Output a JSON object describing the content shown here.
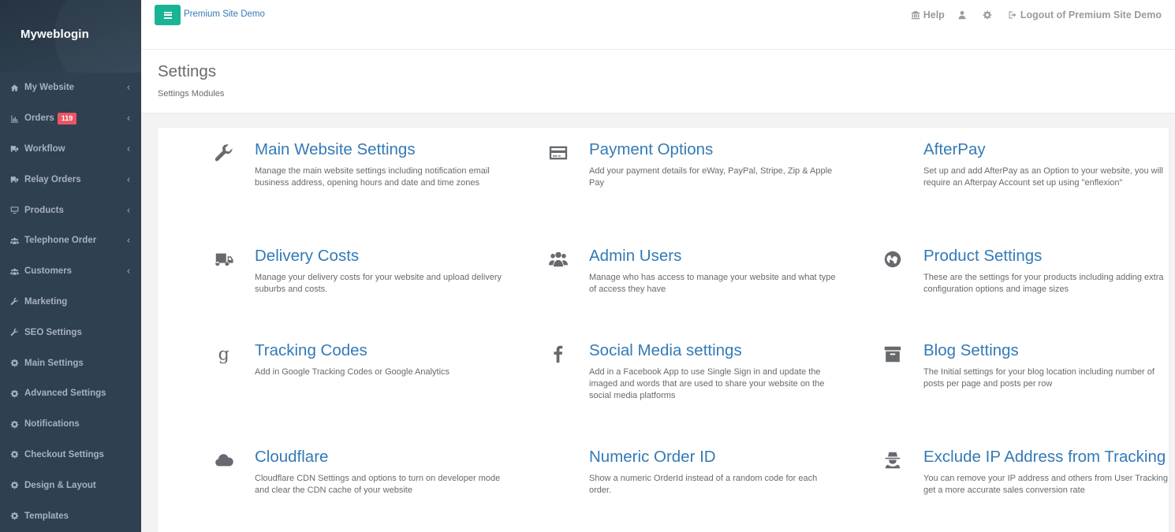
{
  "sidebar": {
    "brand": "Myweblogin",
    "items": [
      {
        "label": "My Website",
        "icon": "home-icon",
        "arrow": "‹"
      },
      {
        "label": "Orders",
        "icon": "bar-chart-icon",
        "arrow": "‹",
        "badge": "119"
      },
      {
        "label": "Workflow",
        "icon": "truck-icon",
        "arrow": "‹"
      },
      {
        "label": "Relay Orders",
        "icon": "truck-icon",
        "arrow": "‹"
      },
      {
        "label": "Products",
        "icon": "desktop-icon",
        "arrow": "‹"
      },
      {
        "label": "Telephone Order",
        "icon": "users-icon",
        "arrow": "‹"
      },
      {
        "label": "Customers",
        "icon": "users-icon",
        "arrow": "‹"
      },
      {
        "label": "Marketing",
        "icon": "wrench-icon"
      },
      {
        "label": "SEO Settings",
        "icon": "wrench-icon"
      },
      {
        "label": "Main Settings",
        "icon": "gear-icon"
      },
      {
        "label": "Advanced Settings",
        "icon": "gear-icon"
      },
      {
        "label": "Notifications",
        "icon": "gear-icon"
      },
      {
        "label": "Checkout Settings",
        "icon": "gear-icon"
      },
      {
        "label": "Design & Layout",
        "icon": "gear-icon"
      },
      {
        "label": "Templates",
        "icon": "gear-icon"
      }
    ]
  },
  "topbar": {
    "site_name": "Premium Site Demo",
    "help_label": "Help",
    "logout_label": "Logout of Premium Site Demo"
  },
  "heading": {
    "title": "Settings",
    "subtitle": "Settings Modules"
  },
  "modules": [
    {
      "title": "Main Website Settings",
      "icon": "wrench-icon",
      "desc": "Manage the main website settings including notification email business address, opening hours and date and time zones"
    },
    {
      "title": "Payment Options",
      "icon": "credit-card-icon",
      "desc": "Add your payment details for eWay, PayPal, Stripe, Zip & Apple Pay"
    },
    {
      "title": "AfterPay",
      "icon": "",
      "desc": "Set up and add AfterPay as an Option to your website, you will require an Afterpay Account set up using \"enflexion\""
    },
    {
      "title": "Delivery Costs",
      "icon": "truck-icon",
      "desc": "Manage your delivery costs for your website and upload delivery suburbs and costs."
    },
    {
      "title": "Admin Users",
      "icon": "users-icon",
      "desc": "Manage who has access to manage your website and what type of access they have"
    },
    {
      "title": "Product Settings",
      "icon": "globe-icon",
      "desc": "These are the settings for your products including adding extra configuration options and image sizes"
    },
    {
      "title": "Tracking Codes",
      "icon": "google-icon",
      "desc": "Add in Google Tracking Codes or Google Analytics"
    },
    {
      "title": "Social Media settings",
      "icon": "facebook-icon",
      "desc": "Add in a Facebook App to use Single Sign in and update the imaged and words that are used to share your website on the social media platforms"
    },
    {
      "title": "Blog Settings",
      "icon": "archive-icon",
      "desc": "The Initial settings for your blog location including number of posts per page and posts per row"
    },
    {
      "title": "Cloudflare",
      "icon": "cloud-icon",
      "desc": "Cloudflare CDN Settings and options to turn on developer mode and clear the CDN cache of your website"
    },
    {
      "title": "Numeric Order ID",
      "icon": "",
      "desc": "Show a numeric OrderId instead of a random code for each order."
    },
    {
      "title": "Exclude IP Address from Tracking",
      "icon": "user-secret-icon",
      "desc": "You can remove your IP address and others from User Tracking get a more accurate sales conversion rate"
    }
  ]
}
